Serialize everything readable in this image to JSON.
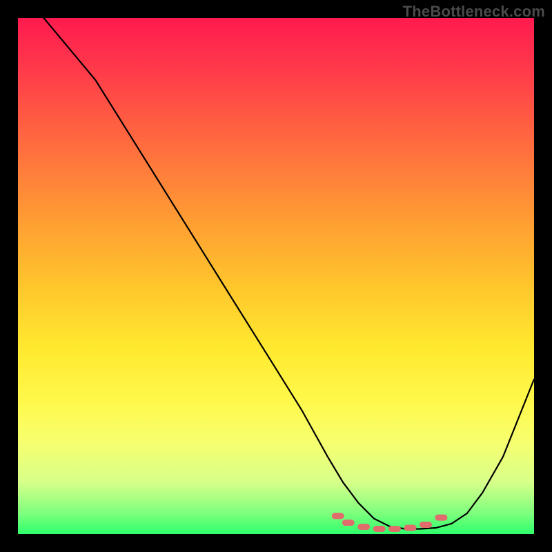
{
  "watermark": "TheBottleneck.com",
  "chart_data": {
    "type": "line",
    "title": "",
    "xlabel": "",
    "ylabel": "",
    "xlim": [
      0,
      100
    ],
    "ylim": [
      0,
      100
    ],
    "series": [
      {
        "name": "curve",
        "x": [
          5,
          10,
          15,
          20,
          25,
          30,
          35,
          40,
          45,
          50,
          55,
          60,
          63,
          66,
          69,
          72,
          75,
          78,
          81,
          84,
          87,
          90,
          94,
          100
        ],
        "y": [
          100,
          94,
          88,
          80,
          72,
          64,
          56,
          48,
          40,
          32,
          24,
          15,
          10,
          6,
          3,
          1.5,
          1,
          1,
          1.2,
          2,
          4,
          8,
          15,
          30
        ]
      }
    ],
    "markers": {
      "name": "highlight-dots",
      "color": "#e06c6c",
      "x": [
        62,
        64,
        67,
        70,
        73,
        76,
        79,
        82
      ],
      "y": [
        3.5,
        2.2,
        1.4,
        1.0,
        1.0,
        1.2,
        1.8,
        3.2
      ]
    },
    "gradient_stops": [
      {
        "pos": 0,
        "color": "#ff1a4f"
      },
      {
        "pos": 24,
        "color": "#ff6a3f"
      },
      {
        "pos": 52,
        "color": "#ffc62c"
      },
      {
        "pos": 74,
        "color": "#fff84a"
      },
      {
        "pos": 96,
        "color": "#7dff7d"
      },
      {
        "pos": 100,
        "color": "#2eff6c"
      }
    ]
  }
}
